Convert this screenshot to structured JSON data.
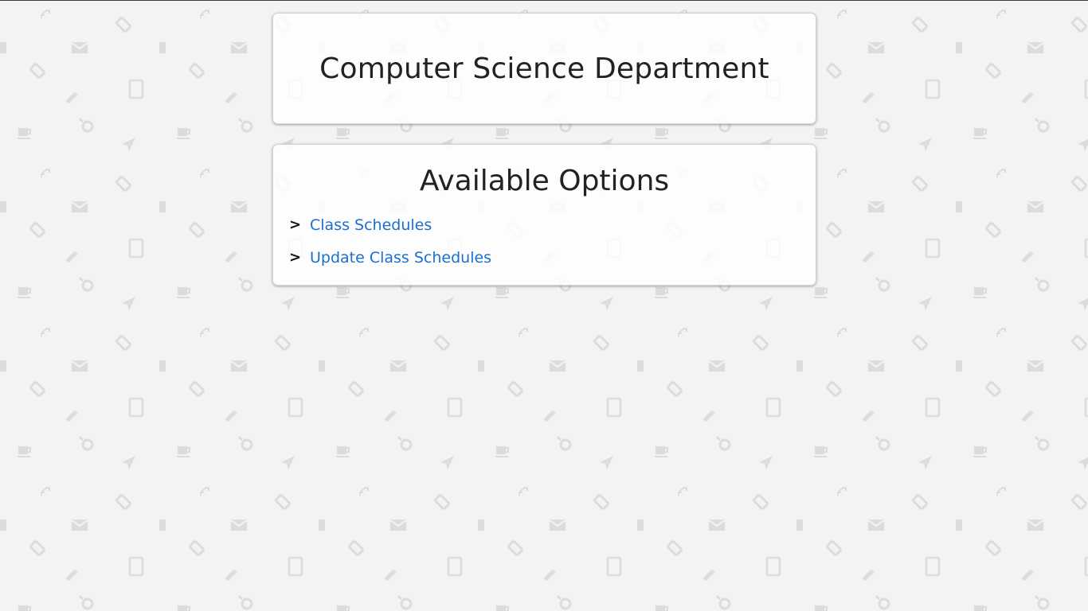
{
  "header": {
    "title": "Computer Science Department"
  },
  "options": {
    "title": "Available Options",
    "items": [
      {
        "marker": ">",
        "label": "Class Schedules"
      },
      {
        "marker": ">",
        "label": "Update Class Schedules"
      }
    ]
  },
  "colors": {
    "background": "#f3f3f3",
    "pattern_icon": "#dedede",
    "link": "#1a6fd0",
    "text": "#222222"
  },
  "background_pattern": {
    "icons": [
      "expand-icon",
      "tag-icon",
      "mail-icon",
      "tablet-icon",
      "pencil-icon",
      "magnifier-icon",
      "coffee-cup-icon",
      "send-icon"
    ]
  }
}
